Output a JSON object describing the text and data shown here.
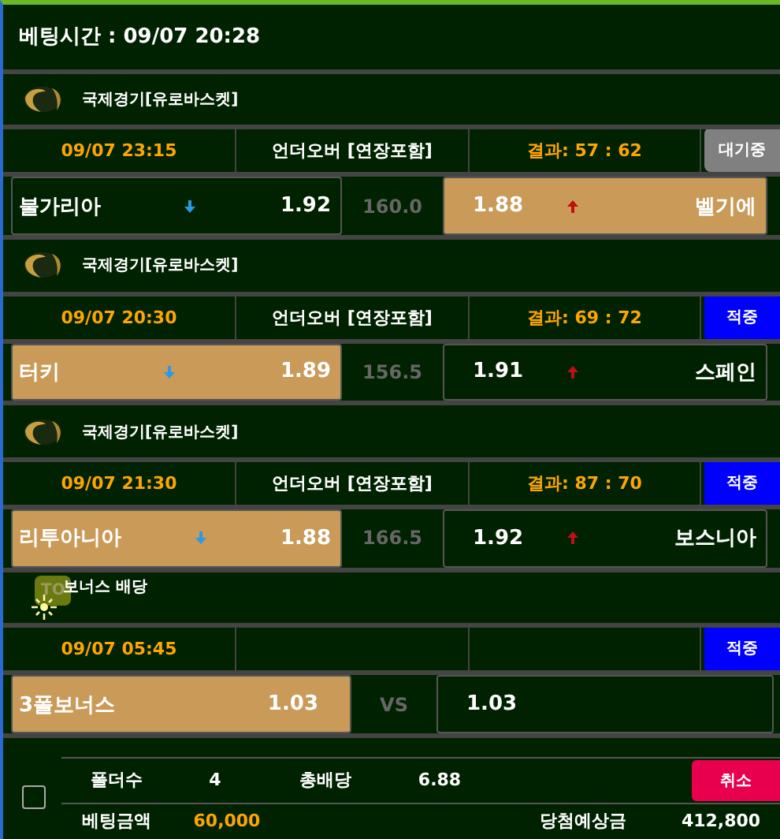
{
  "header": {
    "bet_time": "베팅시간 : 09/07 20:28"
  },
  "games": [
    {
      "league": "국제경기[유로바스켓]",
      "time": "09/07 23:15",
      "market": "언더오버 [연장포함]",
      "result": "결과: 57 : 62",
      "status": {
        "label": "대기중",
        "kind": "pending"
      },
      "home": {
        "name": "불가리아",
        "odds": "1.92",
        "selected": false
      },
      "line": "160.0",
      "away": {
        "odds": "1.88",
        "name": "벨기에",
        "selected": true
      }
    },
    {
      "league": "국제경기[유로바스켓]",
      "time": "09/07 20:30",
      "market": "언더오버 [연장포함]",
      "result": "결과: 69 : 72",
      "status": {
        "label": "적중",
        "kind": "hit"
      },
      "home": {
        "name": "터키",
        "odds": "1.89",
        "selected": true
      },
      "line": "156.5",
      "away": {
        "odds": "1.91",
        "name": "스페인",
        "selected": false
      }
    },
    {
      "league": "국제경기[유로바스켓]",
      "time": "09/07 21:30",
      "market": "언더오버 [연장포함]",
      "result": "결과: 87 : 70",
      "status": {
        "label": "적중",
        "kind": "hit"
      },
      "home": {
        "name": "리투아니아",
        "odds": "1.88",
        "selected": true
      },
      "line": "166.5",
      "away": {
        "odds": "1.92",
        "name": "보스니아",
        "selected": false
      }
    }
  ],
  "bonus": {
    "badge": "TO",
    "title": "보너스 배당",
    "time": "09/07 05:45",
    "status": {
      "label": "적중",
      "kind": "hit"
    },
    "home": {
      "name": "3폴보너스",
      "odds": "1.03",
      "selected": true
    },
    "separator": "VS",
    "away": {
      "odds": "1.03",
      "selected": false
    }
  },
  "footer": {
    "checked": false,
    "fold_label": "폴더수",
    "fold_count": "4",
    "total_odds_label": "총배당",
    "total_odds": "6.88",
    "cancel": "취소",
    "stake_label": "베팅금액",
    "stake": "60,000",
    "payout_label": "당첨예상금",
    "payout": "412,800"
  }
}
